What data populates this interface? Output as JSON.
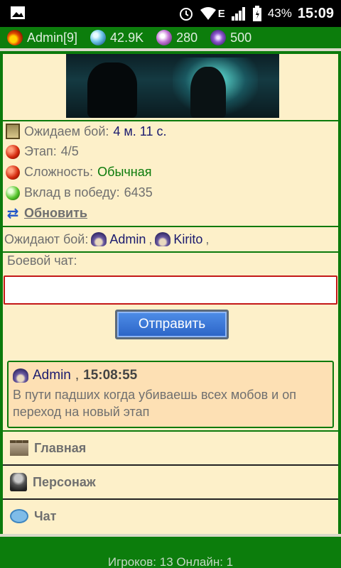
{
  "status_bar": {
    "image_icon": "image-icon",
    "alarm_icon": "alarm-icon",
    "wifi_icon": "wifi-icon",
    "network_type": "E",
    "signal_icon": "signal-icon",
    "battery_icon": "battery-icon",
    "battery": "43%",
    "time": "15:09"
  },
  "header": {
    "player": "Admin[9]",
    "player_icon": "fire-icon",
    "resources": [
      {
        "icon": "orb-icon",
        "value": "42.9K"
      },
      {
        "icon": "crystal-icon",
        "value": "280"
      },
      {
        "icon": "swirl-icon",
        "value": "500"
      }
    ]
  },
  "battle": {
    "wait_label": "Ожидаем бой:",
    "wait_value": "4 м. 11 с.",
    "stage_label": "Этап:",
    "stage_value": "4/5",
    "difficulty_label": "Сложность:",
    "difficulty_value": "Обычная",
    "contribution_label": "Вклад в победу:",
    "contribution_value": "6435",
    "refresh_label": "Обновить",
    "colors": {
      "accent_green": "#0a7a0a",
      "name_blue": "#1a1a6e"
    }
  },
  "waiting": {
    "label": "Ожидают бой:",
    "players": [
      "Admin",
      "Kirito"
    ]
  },
  "chat": {
    "label": "Боевой чат:",
    "input_value": "",
    "send_label": "Отправить",
    "messages": [
      {
        "author": "Admin",
        "time": "15:08:55",
        "text": "В пути падших когда убиваешь всех мобов и оп переход на новый этап"
      }
    ]
  },
  "nav": {
    "items": [
      {
        "label": "Главная",
        "icon": "castle-icon"
      },
      {
        "label": "Персонаж",
        "icon": "hero-icon"
      },
      {
        "label": "Чат",
        "icon": "chat-bubble-icon"
      }
    ]
  },
  "footer": {
    "text": "Игроков: 13 Онлайн: 1"
  }
}
